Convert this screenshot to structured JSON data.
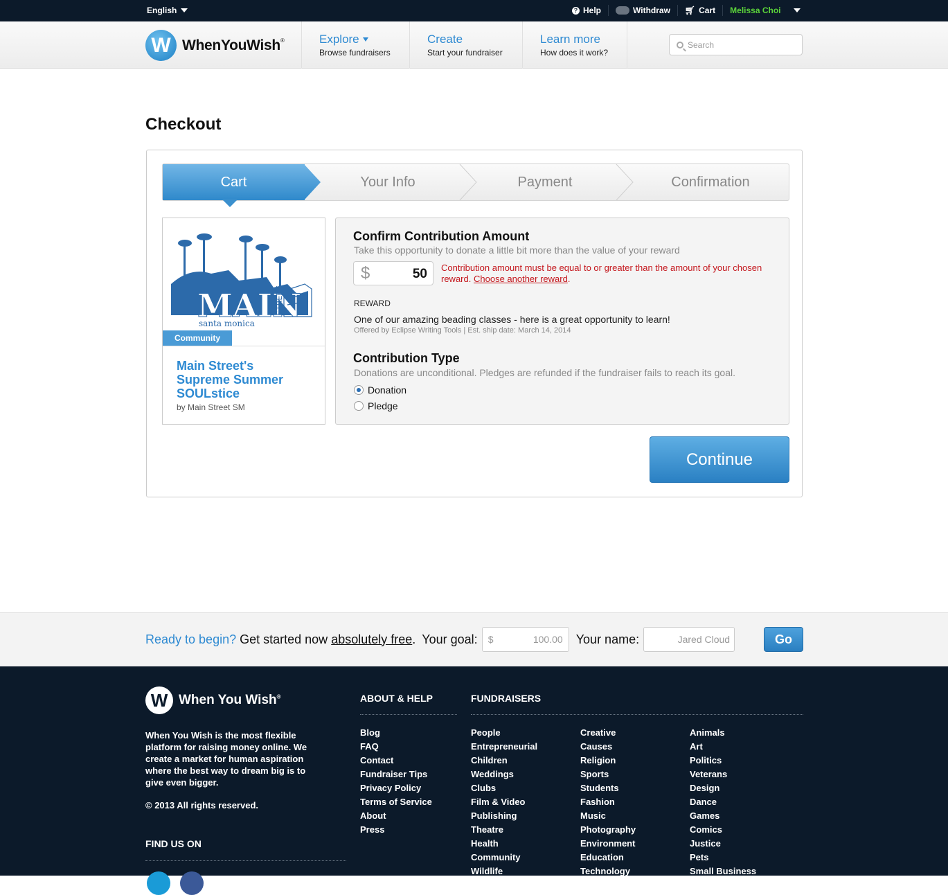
{
  "topbar": {
    "language": "English",
    "help": "Help",
    "withdraw": "Withdraw",
    "cart": "Cart",
    "user": "Melissa Choi"
  },
  "header": {
    "logo_text": "WhenYouWish",
    "logo_letter": "W",
    "nav": [
      {
        "title": "Explore",
        "subtitle": "Browse fundraisers"
      },
      {
        "title": "Create",
        "subtitle": "Start your fundraiser"
      },
      {
        "title": "Learn more",
        "subtitle": "How does it work?"
      }
    ],
    "search_placeholder": "Search"
  },
  "page": {
    "title": "Checkout"
  },
  "steps": [
    "Cart",
    "Your Info",
    "Payment",
    "Confirmation"
  ],
  "campaign": {
    "tag": "Community",
    "title": "Main Street's Supreme Summer SOULstice",
    "by": "by Main Street SM",
    "image_text_main": "MAIN",
    "image_text_street": "STREET",
    "image_text_city": "santa monica"
  },
  "contribution": {
    "heading": "Confirm Contribution Amount",
    "subheading": "Take this opportunity to donate a little bit more than the value of your reward",
    "currency": "$",
    "amount": "50",
    "error_text": "Contribution amount must be equal to or greater than the amount of your chosen reward.",
    "error_link": "Choose another reward",
    "reward_label": "REWARD",
    "reward_desc": "One of our amazing beading classes - here is a great opportunity to learn!",
    "reward_meta": "Offered by Eclipse Writing Tools | Est. ship date: March 14, 2014",
    "type_heading": "Contribution Type",
    "type_sub": "Donations are unconditional. Pledges are refunded if the fundraiser fails to reach its goal.",
    "option_donation": "Donation",
    "option_pledge": "Pledge",
    "continue_label": "Continue"
  },
  "strip": {
    "ready": "Ready to begin?",
    "get_started": "Get started now",
    "free": "absolutely free",
    "goal_label": "Your goal:",
    "goal_currency": "$",
    "goal_value": "100.00",
    "name_label": "Your name:",
    "name_value": "Jared Cloud",
    "go": "Go"
  },
  "footer": {
    "logo_text": "When You Wish",
    "description": "When You Wish is the most flexible platform for raising money online. We create a market for human aspiration where the best way to dream big is to give even bigger.",
    "copyright": "© 2013 All rights reserved.",
    "find_us": "FIND US ON",
    "about_heading": "ABOUT & HELP",
    "fundraisers_heading": "FUNDRAISERS",
    "about_links": [
      "Blog",
      "FAQ",
      "Contact",
      "Fundraiser Tips",
      "Privacy Policy",
      "Terms of Service",
      "About",
      "Press"
    ],
    "fund_col1": [
      "People",
      "Entrepreneurial",
      "Children",
      "Weddings",
      "Clubs",
      "Film & Video",
      "Publishing",
      "Theatre",
      "Health",
      "Community",
      "Wildlife"
    ],
    "fund_col2": [
      "Creative",
      "Causes",
      "Religion",
      "Sports",
      "Students",
      "Fashion",
      "Music",
      "Photography",
      "Environment",
      "Education",
      "Technology"
    ],
    "fund_col3": [
      "Animals",
      "Art",
      "Politics",
      "Veterans",
      "Design",
      "Dance",
      "Games",
      "Comics",
      "Justice",
      "Pets",
      "Small Business"
    ]
  },
  "colors": {
    "brand_blue": "#2e8ad2",
    "dark_navy": "#0c1a2a",
    "error_red": "#c4161c",
    "user_green": "#5bd23a"
  }
}
